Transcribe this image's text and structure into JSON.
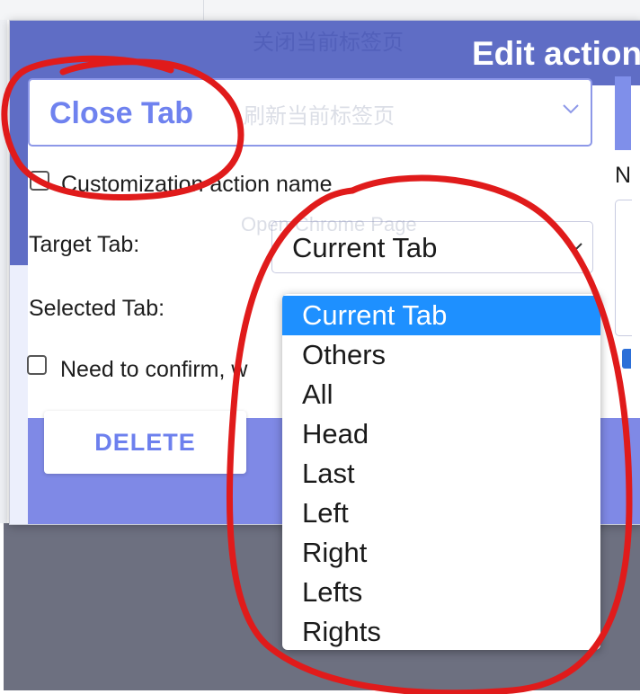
{
  "dialog": {
    "title": "Edit action",
    "ghost_title": "关闭当前标签页",
    "action_select": {
      "value": "Close Tab",
      "ghost_text": "刷新当前标签页",
      "chevron_icon": "chevron-down-icon"
    },
    "customization_label": "Customization action name",
    "target_tab_label": "Target Tab:",
    "selected_tab_label": "Selected Tab:",
    "confirm_label": "Need to confirm, w",
    "target_select": {
      "value": "Current Tab",
      "ghost_text": "Open Chrome Page",
      "chevron_icon": "chevron-down-icon"
    },
    "delete_label": "DELETE",
    "right_label": "N"
  },
  "dropdown": {
    "options": [
      "Current Tab",
      "Others",
      "All",
      "Head",
      "Last",
      "Left",
      "Right",
      "Lefts",
      "Rights"
    ],
    "selected_index": 0
  },
  "colors": {
    "header": "#5f6dc5",
    "footer": "#7f89e6",
    "accent": "#6f82ef",
    "selected_option": "#1e90ff",
    "annotation_red": "#e01b1b"
  }
}
